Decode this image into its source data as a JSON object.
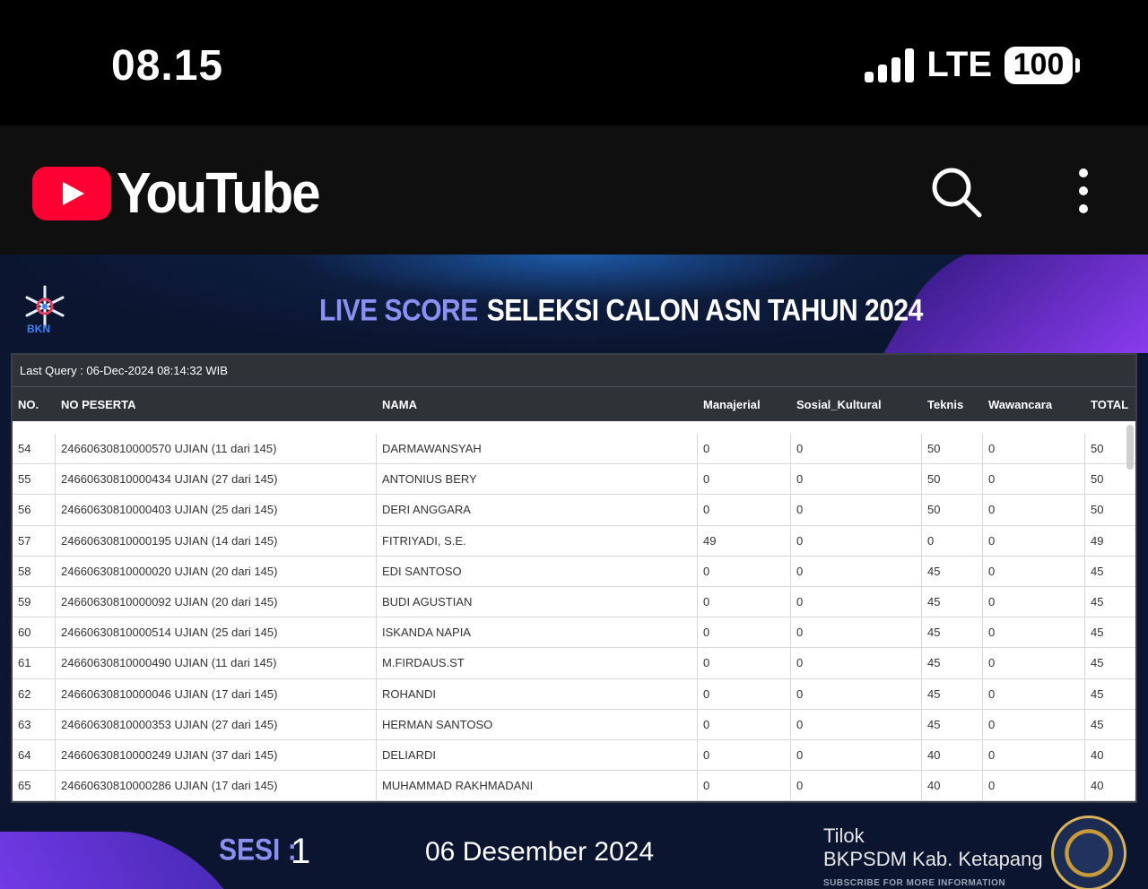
{
  "status_bar": {
    "time": "08.15",
    "network": "LTE",
    "battery": "100"
  },
  "app_bar": {
    "brand": "YouTube",
    "icons": [
      "youtube-play-icon",
      "search-icon",
      "more-vert-icon"
    ]
  },
  "video": {
    "logo_text": "BKN",
    "title_live": "LIVE SCORE",
    "title_main": "SELEKSI CALON ASN TAHUN 2024",
    "table": {
      "last_query": "Last Query : 06-Dec-2024 08:14:32 WIB",
      "headers": [
        "NO.",
        "NO PESERTA",
        "NAMA",
        "Manajerial",
        "Sosial_Kultural",
        "Teknis",
        "Wawancara",
        "TOTAL"
      ],
      "rows": [
        [
          "54",
          "24660630810000570 UJIAN (11 dari 145)",
          "DARMAWANSYAH",
          "0",
          "0",
          "50",
          "0",
          "50"
        ],
        [
          "55",
          "24660630810000434 UJIAN (27 dari 145)",
          "ANTONIUS BERY",
          "0",
          "0",
          "50",
          "0",
          "50"
        ],
        [
          "56",
          "24660630810000403 UJIAN (25 dari 145)",
          "DERI ANGGARA",
          "0",
          "0",
          "50",
          "0",
          "50"
        ],
        [
          "57",
          "24660630810000195 UJIAN (14 dari 145)",
          "FITRIYADI, S.E.",
          "49",
          "0",
          "0",
          "0",
          "49"
        ],
        [
          "58",
          "24660630810000020 UJIAN (20 dari 145)",
          "EDI SANTOSO",
          "0",
          "0",
          "45",
          "0",
          "45"
        ],
        [
          "59",
          "24660630810000092 UJIAN (20 dari 145)",
          "BUDI AGUSTIAN",
          "0",
          "0",
          "45",
          "0",
          "45"
        ],
        [
          "60",
          "24660630810000514 UJIAN (25 dari 145)",
          "ISKANDA NAPIA",
          "0",
          "0",
          "45",
          "0",
          "45"
        ],
        [
          "61",
          "24660630810000490 UJIAN (11 dari 145)",
          "M.FIRDAUS.ST",
          "0",
          "0",
          "45",
          "0",
          "45"
        ],
        [
          "62",
          "24660630810000046 UJIAN (17 dari 145)",
          "ROHANDI",
          "0",
          "0",
          "45",
          "0",
          "45"
        ],
        [
          "63",
          "24660630810000353 UJIAN (27 dari 145)",
          "HERMAN SANTOSO",
          "0",
          "0",
          "45",
          "0",
          "45"
        ],
        [
          "64",
          "24660630810000249 UJIAN (37 dari 145)",
          "DELIARDI",
          "0",
          "0",
          "40",
          "0",
          "40"
        ],
        [
          "65",
          "24660630810000286 UJIAN (17 dari 145)",
          "MUHAMMAD RAKHMADANI",
          "0",
          "0",
          "40",
          "0",
          "40"
        ]
      ]
    },
    "footer": {
      "sesi_label": "SESI :",
      "sesi_value": "1",
      "date": "06 Desember 2024",
      "org_line1": "Tilok",
      "org_line2": "BKPSDM Kab. Ketapang",
      "org_line3": "SUBSCRIBE FOR MORE INFORMATION"
    }
  },
  "colors": {
    "youtube_red": "#ff0033",
    "title_accent": "#8b8ff0",
    "video_bg": "#0c1630",
    "table_header": "#2f3337"
  }
}
